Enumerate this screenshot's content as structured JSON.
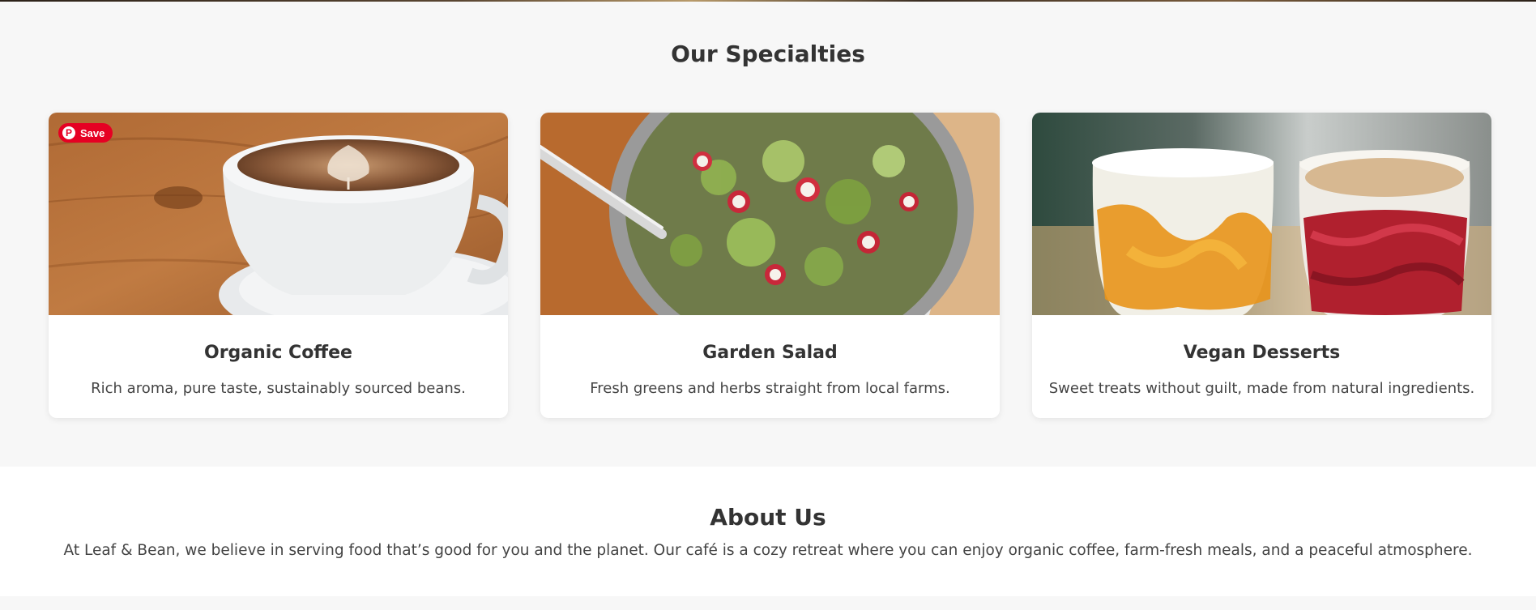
{
  "specialties": {
    "title": "Our Specialties",
    "cards": [
      {
        "title": "Organic Coffee",
        "description": "Rich aroma, pure taste, sustainably sourced beans."
      },
      {
        "title": "Garden Salad",
        "description": "Fresh greens and herbs straight from local farms."
      },
      {
        "title": "Vegan Desserts",
        "description": "Sweet treats without guilt, made from natural ingredients."
      }
    ],
    "pinterest_save_label": "Save",
    "pinterest_icon": "pinterest-icon",
    "pinterest_color": "#e60023"
  },
  "about": {
    "title": "About Us",
    "text": "At Leaf & Bean, we believe in serving food that’s good for you and the planet. Our café is a cozy retreat where you can enjoy organic coffee, farm-fresh meals, and a peaceful atmosphere."
  }
}
